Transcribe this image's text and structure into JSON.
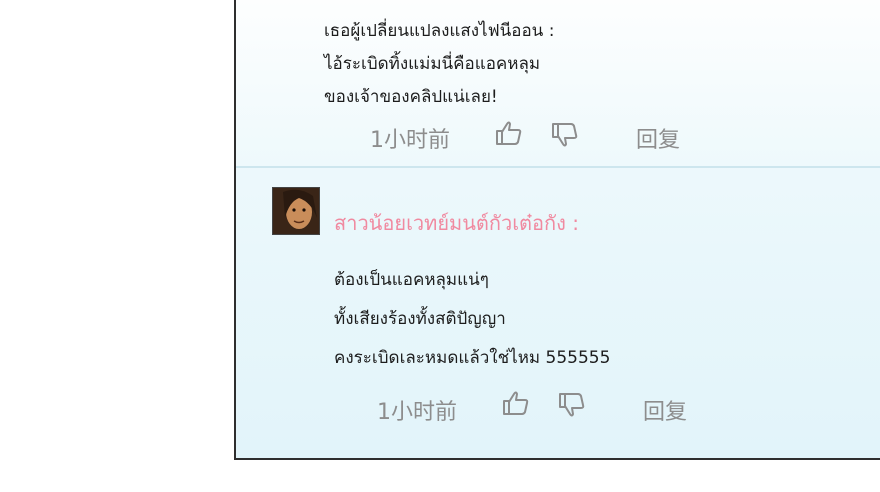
{
  "comments": [
    {
      "lines": [
        "เธอผู้เปลี่ยนแปลงแสงไฟนีออน :",
        "ไอ้ระเบิดทิ้งแม่มนี่คือแอคหลุม",
        "ของเจ้าของคลิปแน่เลย!"
      ],
      "time": "1小时前",
      "reply_label": "回复",
      "like_icon": "thumbs-up-icon",
      "dislike_icon": "thumbs-down-icon"
    },
    {
      "username": "สาวน้อยเวทย์มนต์กัวเต๋อกัง :",
      "avatar_icon": "user-avatar",
      "lines": [
        "ต้องเป็นแอคหลุมแน่ๆ",
        "ทั้งเสียงร้องทั้งสติปัญญา",
        "คงระเบิดเละหมดแล้วใช่ไหม 555555"
      ],
      "time": "1小时前",
      "reply_label": "回复",
      "like_icon": "thumbs-up-icon",
      "dislike_icon": "thumbs-down-icon"
    }
  ],
  "colors": {
    "username": "#f08aa0",
    "meta": "#8d8d8d",
    "border": "#2e2e2e"
  }
}
